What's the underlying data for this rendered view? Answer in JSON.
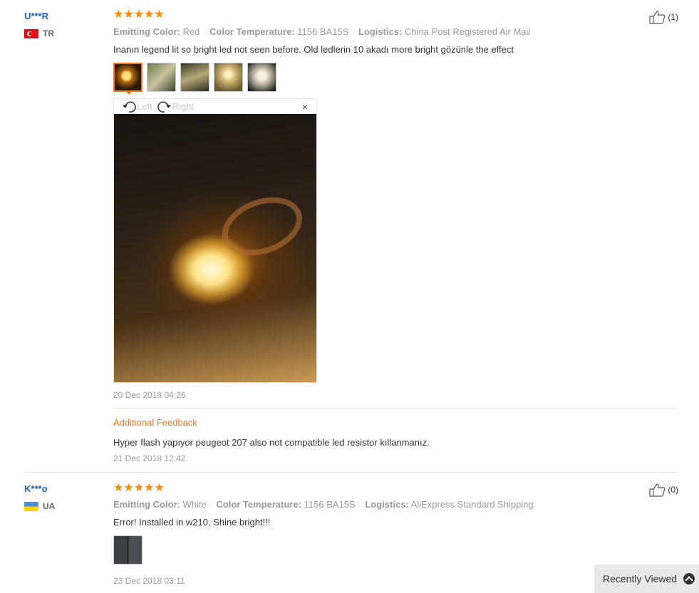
{
  "reviews": [
    {
      "user": "U***R",
      "country": "TR",
      "stars": "★★★★★",
      "attrs": [
        {
          "key": "Emitting Color:",
          "value": "Red"
        },
        {
          "key": "Color Temperature:",
          "value": "1156 BA15S"
        },
        {
          "key": "Logistics:",
          "value": "China Post Registered Air Mail"
        }
      ],
      "text": "Inanın legend lit so bright led not seen before. Old ledlerin 10 akadı more bright gözünle the effect",
      "photos_count": 5,
      "viewer": {
        "left_label": "Left",
        "right_label": "Right",
        "close": "×"
      },
      "date": "20 Dec 2018 04:26",
      "additional_title": "Additional Feedback",
      "additional_text": "Hyper flash yapıyor peugeot 207 also not compatible led resistor kıllanmanız.",
      "additional_date": "21 Dec 2018 12:42",
      "useful": "(1)"
    },
    {
      "user": "K***o",
      "country": "UA",
      "stars": "★★★★★",
      "attrs": [
        {
          "key": "Emitting Color:",
          "value": "White"
        },
        {
          "key": "Color Temperature:",
          "value": "1156 BA15S"
        },
        {
          "key": "Logistics:",
          "value": "AliExpress Standard Shipping"
        }
      ],
      "text": "Error! Installed in w210. Shine bright!!!",
      "photos_count": 1,
      "date": "23 Dec 2018 03:11",
      "useful": "(0)"
    }
  ],
  "recently_viewed": "Recently Viewed",
  "colors": {
    "accent": "#ff7519",
    "star": "#ff8a00",
    "name": "#1f5bad"
  }
}
